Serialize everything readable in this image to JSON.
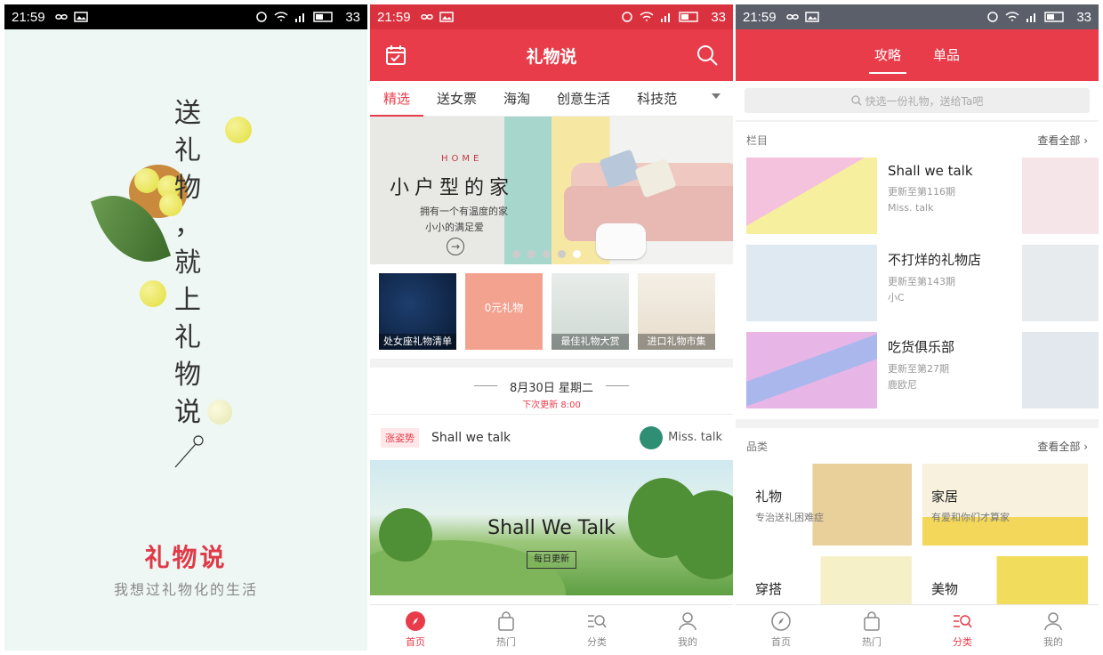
{
  "status": {
    "time": "21:59",
    "battery": "33"
  },
  "splash": {
    "vertical_text": [
      "送",
      "礼",
      "物",
      "，",
      "就",
      "上",
      "礼",
      "物",
      "说"
    ],
    "brand": "礼物说",
    "slogan": "我想过礼物化的生活"
  },
  "home": {
    "title": "礼物说",
    "tabs": [
      "精选",
      "送女票",
      "海淘",
      "创意生活",
      "科技范"
    ],
    "banner": {
      "kicker": "HOME",
      "headline": "小户型的家",
      "line1": "拥有一个有温度的家",
      "line2": "小小的满足爱"
    },
    "topics": [
      "处女座礼物清单",
      "0元礼物",
      "最佳礼物大赏",
      "进口礼物市集"
    ],
    "date": "8月30日 星期二",
    "next_update": "下次更新 8:00",
    "post": {
      "tag": "涨姿势",
      "name": "Shall we talk",
      "author": "Miss. talk",
      "image_title": "Shall We Talk",
      "image_button": "每日更新"
    }
  },
  "nav": [
    "首页",
    "热门",
    "分类",
    "我的"
  ],
  "category": {
    "tabs": [
      "攻略",
      "单品"
    ],
    "search_placeholder": "快选一份礼物，送给Ta吧",
    "columns_label": "栏目",
    "view_all": "查看全部 ›",
    "columns": [
      {
        "name": "Shall we talk",
        "issue": "更新至第116期",
        "author": "Miss. talk"
      },
      {
        "name": "不打烊的礼物店",
        "issue": "更新至第143期",
        "author": "小C"
      },
      {
        "name": "吃货俱乐部",
        "issue": "更新至第27期",
        "author": "鹿欧尼"
      }
    ],
    "categories_label": "品类",
    "categories": [
      {
        "name": "礼物",
        "desc": "专治送礼困难症"
      },
      {
        "name": "家居",
        "desc": "有爱和你们才算家"
      },
      {
        "name": "穿搭",
        "desc": ""
      },
      {
        "name": "美物",
        "desc": ""
      }
    ]
  },
  "colors": {
    "accent": "#e83c4a",
    "splash_bg": "#eef7f4"
  }
}
